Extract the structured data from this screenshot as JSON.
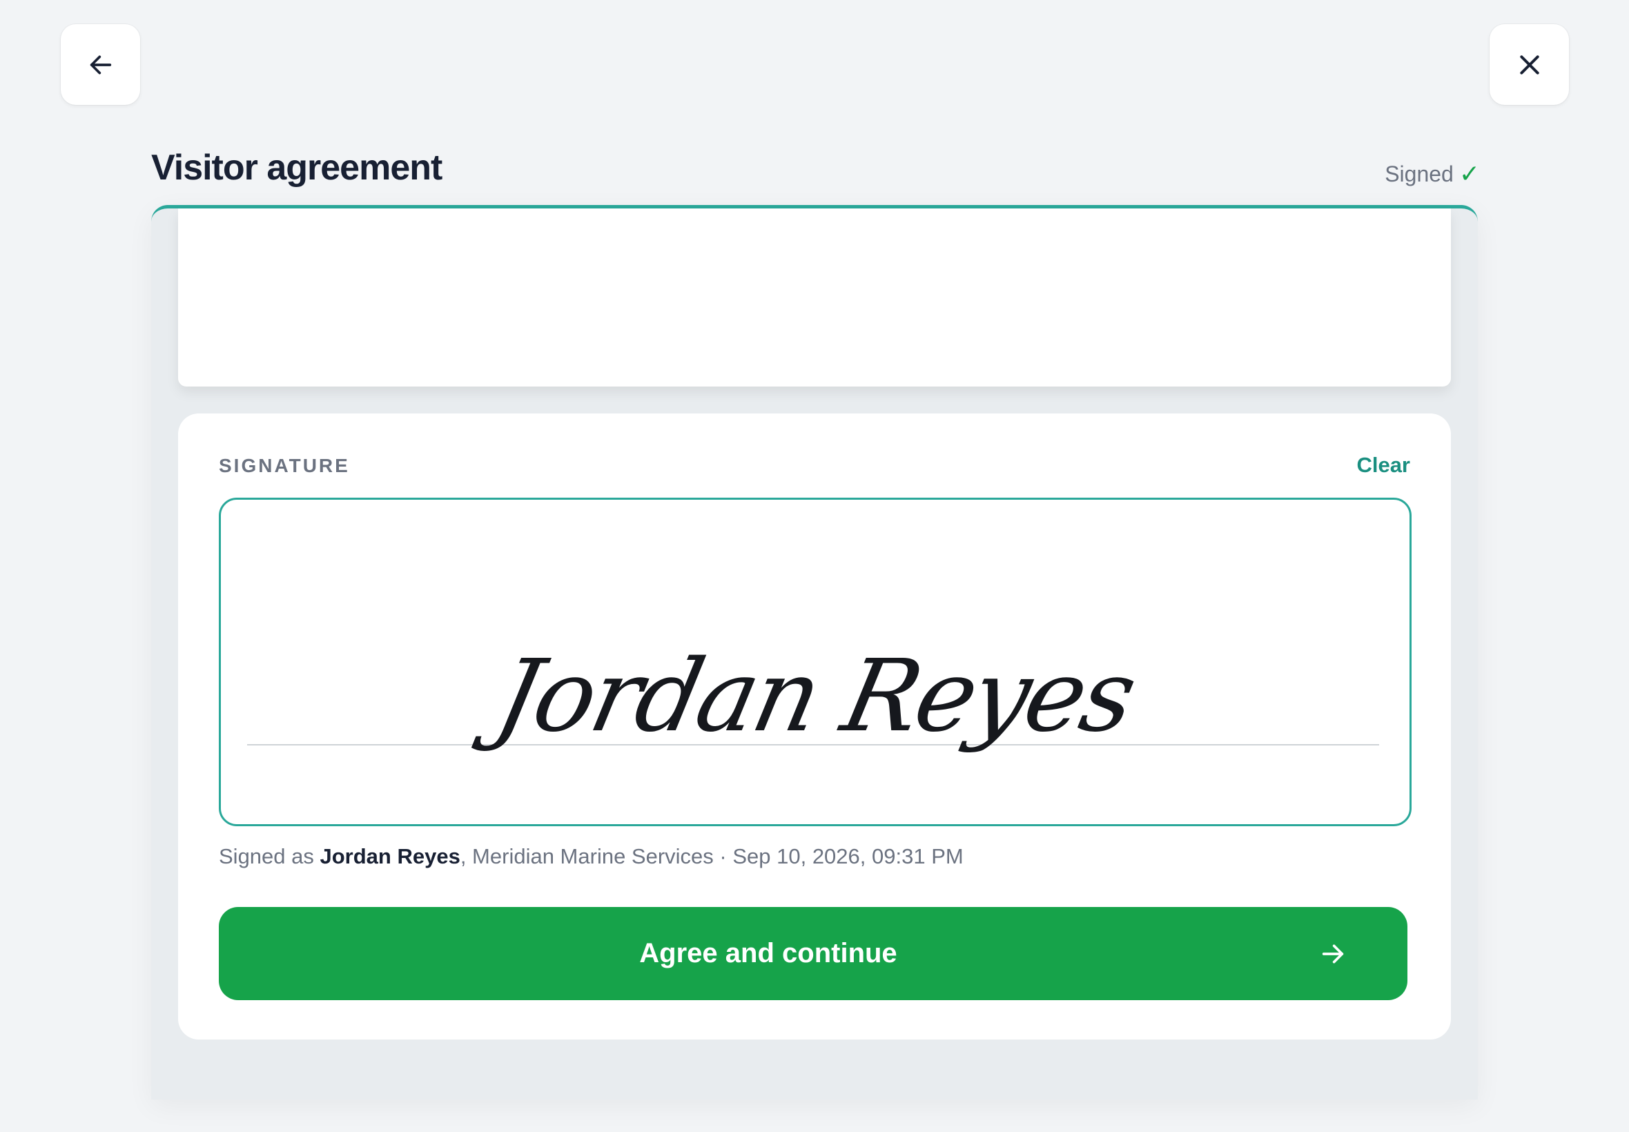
{
  "header": {
    "back_icon": "arrow-left-icon",
    "close_icon": "close-icon",
    "title": "Visitor agreement",
    "status_label": "Signed",
    "status_mark": "✓",
    "status_color": "#16a34a"
  },
  "signature": {
    "section_label": "SIGNATURE",
    "clear_label": "Clear",
    "ink_text": "Jordan Reyes",
    "signed_as_prefix": "Signed as ",
    "signer_name": "Jordan Reyes",
    "signed_as_suffix": ", Meridian Marine Services · Sep 10, 2026, 09:31 PM"
  },
  "actions": {
    "agree_label": "Agree and continue",
    "agree_icon": "arrow-right-icon",
    "agree_color": "#16a34a"
  },
  "theme": {
    "accent": "#2aa89a",
    "link": "#1a8f80"
  }
}
